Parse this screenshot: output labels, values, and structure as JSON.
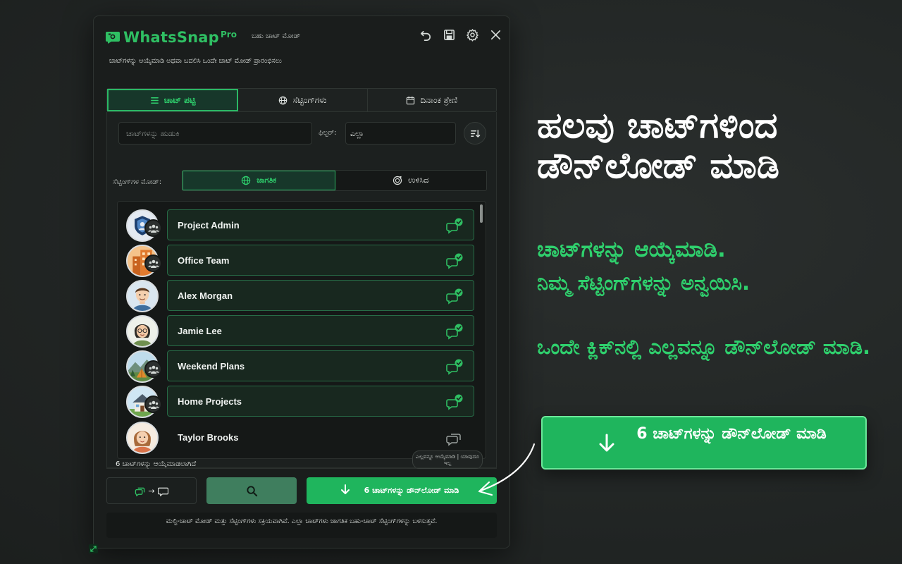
{
  "app": {
    "brand": "WhatsSnap",
    "badge": "Pro",
    "mode_title": "ಬಹು ಚಾಟ್ ಮೋಡ್",
    "hint": "ಚಾಟ್‌ಗಳನ್ನು ಆಯ್ಕೆಮಾಡಿ ಅಥವಾ ಬದಲಿಸಿ ಒಂದೇ ಚಾಟ್ ಮೋಡ್ ಪ್ರಾರಂಭಿಸಲು",
    "titlebar_icons": [
      "undo-icon",
      "save-icon",
      "gear-icon",
      "close-icon"
    ],
    "accent": "#2fbf63"
  },
  "tabs": [
    {
      "label": "ಚಾಟ್ ಪಟ್ಟಿ",
      "icon": "list-icon",
      "active": true
    },
    {
      "label": "ಸೆಟ್ಟಿಂಗ್‌ಗಳು",
      "icon": "globe-icon",
      "active": false
    },
    {
      "label": "ದಿನಾಂಕ ಶ್ರೇಣಿ",
      "icon": "calendar-icon",
      "active": false
    }
  ],
  "search": {
    "placeholder": "ಚಾಟ್‌ಗಳನ್ನು ಹುಡುಕಿ",
    "value": ""
  },
  "filter": {
    "label": "ಫಿಲ್ಟರ್:",
    "value": "ಎಲ್ಲಾ"
  },
  "settings_mode": {
    "label": "ಸೆಟ್ಟಿಂಗ್‌ಗಳ ಮೋಡ್:",
    "options": [
      {
        "label": "ಜಾಗತಿಕ",
        "icon": "globe-icon",
        "active": true
      },
      {
        "label": "ಉಳಿಸಿದ",
        "icon": "saved-icon",
        "active": false
      }
    ]
  },
  "chats": [
    {
      "name": "Project Admin",
      "avatar": "shield-avatar",
      "group": true,
      "selected": true
    },
    {
      "name": "Office Team",
      "avatar": "office-avatar",
      "group": true,
      "selected": true
    },
    {
      "name": "Alex Morgan",
      "avatar": "man-avatar",
      "group": false,
      "selected": true
    },
    {
      "name": "Jamie Lee",
      "avatar": "woman-glasses-avatar",
      "group": false,
      "selected": true
    },
    {
      "name": "Weekend Plans",
      "avatar": "camping-avatar",
      "group": true,
      "selected": true
    },
    {
      "name": "Home Projects",
      "avatar": "house-avatar",
      "group": true,
      "selected": true
    },
    {
      "name": "Taylor Brooks",
      "avatar": "woman-avatar",
      "group": false,
      "selected": false
    }
  ],
  "selection": {
    "count_text": "6 ಚಾಟ್‌ಗಳನ್ನು ಆಯ್ಕೆಮಾಡಲಾಗಿದೆ",
    "tooltip": "ಎಲ್ಲವನ್ನೂ ಆಯ್ಕೆಮಾಡಿ | ಯಾವುದೂ ಇಲ್ಲ"
  },
  "buttons": {
    "download": "6 ಚಾಟ್‌ಗಳನ್ನು ಡೌನ್‌ಲೋಡ್ ಮಾಡಿ"
  },
  "status": "ಮಲ್ಟಿ-ಚಾಟ್ ಮೋಡ್ ಮತ್ತು ಸೆಟ್ಟಿಂಗ್‌ಗಳು ಸಕ್ರಿಯವಾಗಿವೆ. ಎಲ್ಲಾ ಚಾಟ್‌ಗಳು ಜಾಗತಿಕ ಬಹು-ಚಾಟ್ ಸೆಟ್ಟಿಂಗ್‌ಗಳನ್ನು ಬಳಸುತ್ತವೆ.",
  "promo": {
    "title": "ಹಲವು ಚಾಟ್‌ಗಳಿಂದ ಡೌನ್‌ಲೋಡ್ ಮಾಡಿ",
    "line1": "ಚಾಟ್‌ಗಳನ್ನು ಆಯ್ಕೆಮಾಡಿ.",
    "line2": "ನಿಮ್ಮ ಸೆಟ್ಟಿಂಗ್‌ಗಳನ್ನು ಅನ್ವಯಿಸಿ.",
    "line3": "ಒಂದೇ ಕ್ಲಿಕ್‌ನಲ್ಲಿ ಎಲ್ಲವನ್ನೂ ಡೌನ್‌ಲೋಡ್ ಮಾಡಿ.",
    "cta": "6 ಚಾಟ್‌ಗಳನ್ನು ಡೌನ್‌ಲೋಡ್ ಮಾಡಿ"
  }
}
